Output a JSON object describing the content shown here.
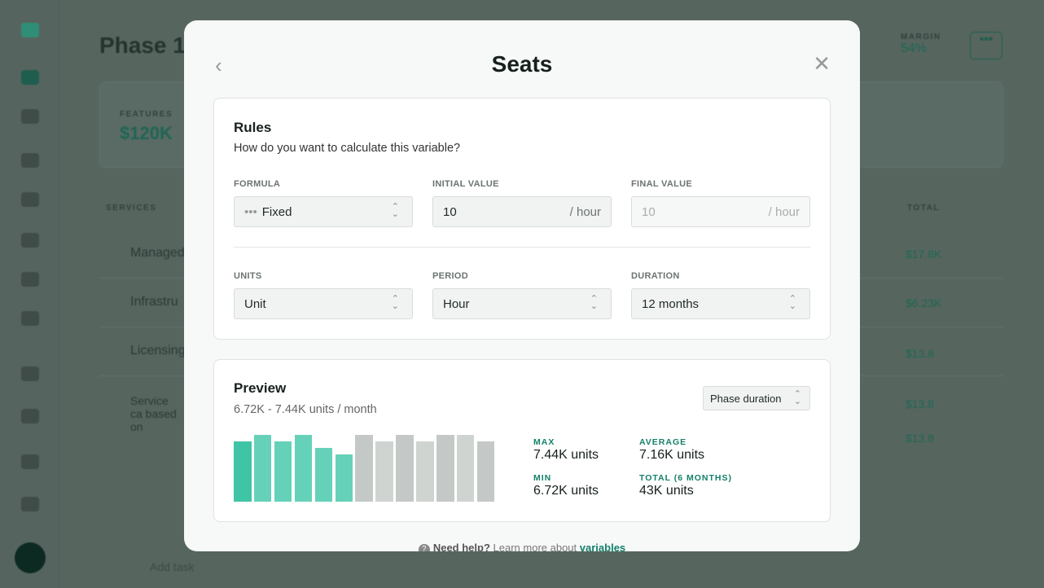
{
  "background": {
    "page_title": "Phase 1",
    "features_label": "FEATURES",
    "features_value": "$120K",
    "margin_label": "MARGIN",
    "margin_value": "54%",
    "services_label": "SERVICES",
    "total_label": "TOTAL",
    "services": [
      {
        "name": "Managed",
        "total": "$17.8K"
      },
      {
        "name": "Infrastru",
        "total": "$6.23K"
      },
      {
        "name": "Licensing",
        "total": "$13.8"
      }
    ],
    "desc": "Service ca based on",
    "extra_totals": [
      "$13.8",
      "$13.8"
    ],
    "add_task": "Add task"
  },
  "modal": {
    "title": "Seats",
    "rules": {
      "heading": "Rules",
      "subheading": "How do you want to calculate this variable?",
      "formula": {
        "label": "FORMULA",
        "value": "Fixed"
      },
      "initial": {
        "label": "INITIAL VALUE",
        "value": "10",
        "suffix": "/ hour"
      },
      "final": {
        "label": "FINAL VALUE",
        "placeholder": "10",
        "suffix": "/ hour"
      },
      "units": {
        "label": "UNITS",
        "value": "Unit"
      },
      "period": {
        "label": "PERIOD",
        "value": "Hour"
      },
      "duration": {
        "label": "DURATION",
        "value": "12 months"
      }
    },
    "preview": {
      "heading": "Preview",
      "range": "6.72K - 7.44K units / month",
      "selector": "Phase duration",
      "stats": {
        "max_label": "MAX",
        "max": "7.44K units",
        "avg_label": "AVERAGE",
        "avg": "7.16K units",
        "min_label": "MIN",
        "min": "6.72K units",
        "total_label": "TOTAL (6 MONTHS)",
        "total": "43K units"
      }
    },
    "help": {
      "strong": "Need help?",
      "text": "Learn more about",
      "link": "variables"
    }
  },
  "chart_data": {
    "type": "bar",
    "values": [
      7.2,
      7.44,
      7.2,
      7.44,
      6.96,
      6.72,
      7.44,
      7.2,
      7.44,
      7.2,
      7.44,
      7.44,
      7.2
    ],
    "unit": "K units",
    "highlighted_count": 6,
    "colors": {
      "highlight": "#66d1b9",
      "first": "#40c4a6",
      "rest": "#cfd4d1",
      "alt": "#c4c9c7"
    }
  }
}
